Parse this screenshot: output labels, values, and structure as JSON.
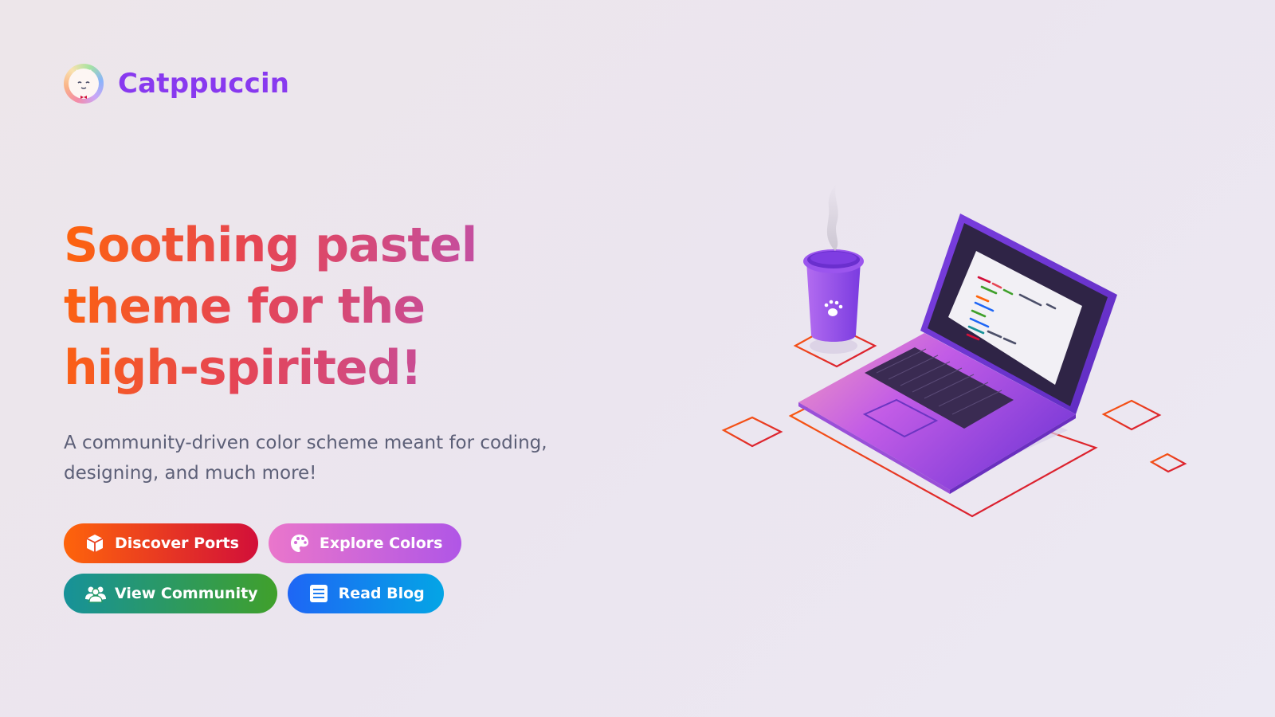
{
  "brand": {
    "name": "Catppuccin",
    "logo_icon": "cat-logo-icon",
    "color": "#8839ef"
  },
  "hero": {
    "headline_lines": [
      "Soothing pastel",
      "theme for the",
      "high-spirited!"
    ],
    "tagline": "A community-driven color scheme meant for coding, designing, and much more!"
  },
  "buttons": [
    {
      "label": "Discover Ports",
      "icon": "package-icon",
      "color_start": "#fe640b",
      "color_end": "#d20f39"
    },
    {
      "label": "Explore Colors",
      "icon": "palette-icon",
      "color_start": "#ea76cb",
      "color_end": "#b056e6"
    },
    {
      "label": "View Community",
      "icon": "people-icon",
      "color_start": "#179299",
      "color_end": "#40a02b"
    },
    {
      "label": "Read Blog",
      "icon": "document-icon",
      "color_start": "#1e66f5",
      "color_end": "#04a5e5"
    }
  ],
  "illustration": {
    "subjects": [
      "laptop-icon",
      "coffee-cup-icon"
    ]
  }
}
